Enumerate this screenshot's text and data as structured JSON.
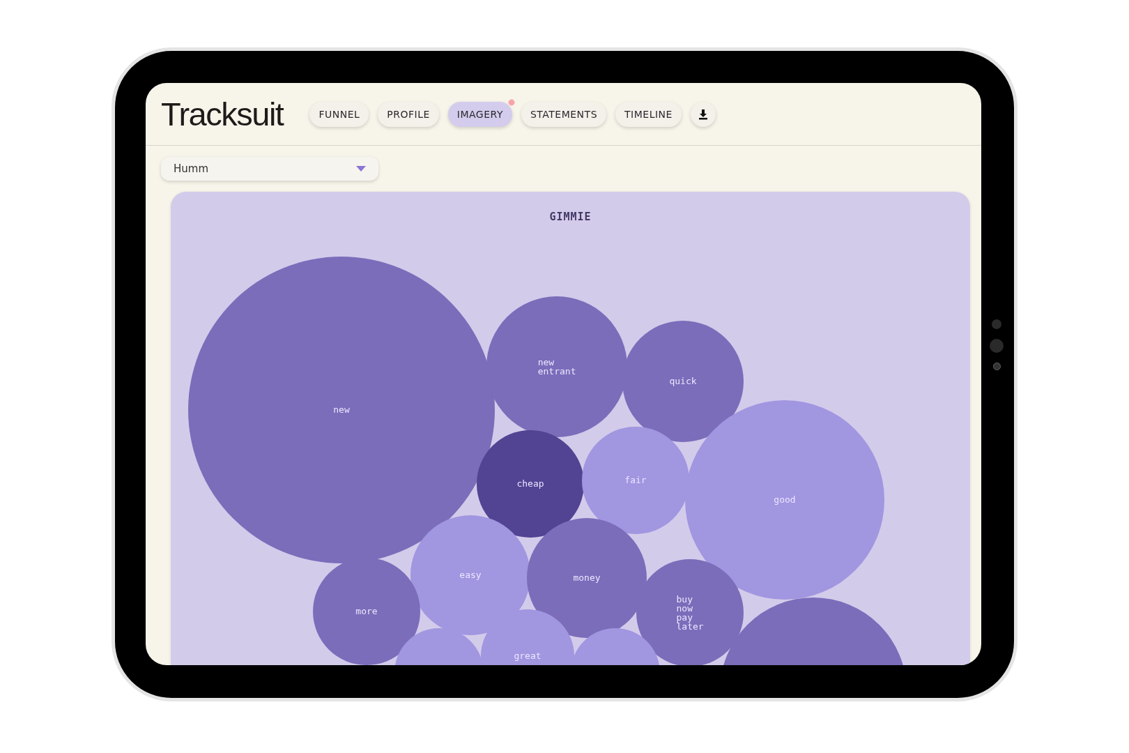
{
  "app": {
    "logo": "Tracksuit"
  },
  "tabs": [
    {
      "label": "FUNNEL",
      "selected": false,
      "notification": false
    },
    {
      "label": "PROFILE",
      "selected": false,
      "notification": false
    },
    {
      "label": "IMAGERY",
      "selected": true,
      "notification": true
    },
    {
      "label": "STATEMENTS",
      "selected": false,
      "notification": false
    },
    {
      "label": "TIMELINE",
      "selected": false,
      "notification": false
    }
  ],
  "brand_select": {
    "value": "Humm"
  },
  "chart": {
    "title": "GIMMIE",
    "bubbles": [
      {
        "label": "new",
        "color": "#7b6dba"
      },
      {
        "label": "new entrant",
        "color": "#7b6dba"
      },
      {
        "label": "quick",
        "color": "#7b6dba"
      },
      {
        "label": "cheap",
        "color": "#524393"
      },
      {
        "label": "fair",
        "color": "#a196e0"
      },
      {
        "label": "good",
        "color": "#a196e0"
      },
      {
        "label": "easy",
        "color": "#a196e0"
      },
      {
        "label": "money",
        "color": "#7b6dba"
      },
      {
        "label": "more",
        "color": "#7b6dba"
      },
      {
        "label": "buy now pay later",
        "color": "#7b6dba"
      },
      {
        "label": "great",
        "color": "#a196e0"
      },
      {
        "color": "#a196e0"
      },
      {
        "color": "#a196e0"
      },
      {
        "color": "#7b6dba"
      }
    ]
  }
}
